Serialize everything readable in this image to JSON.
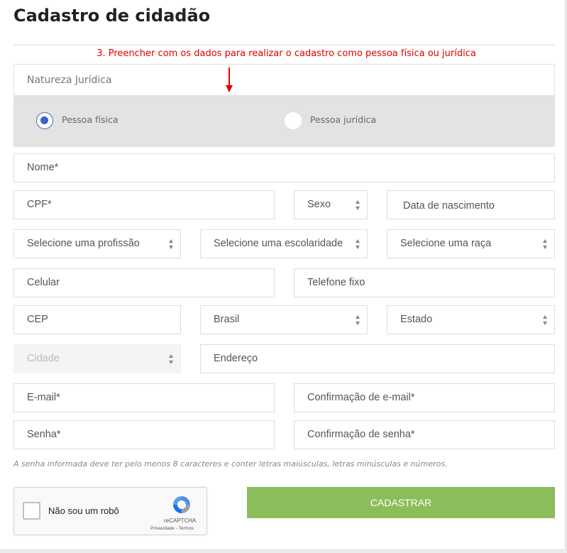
{
  "page": {
    "title": "Cadastro de cidadão"
  },
  "annotation": {
    "text": "3. Preencher com os dados para realizar o cadastro como pessoa física ou jurídica",
    "color": "#e00000"
  },
  "natureza": {
    "label": "Natureza Jurídica",
    "options": [
      {
        "label": "Pessoa física",
        "checked": true
      },
      {
        "label": "Pessoa jurídica",
        "checked": false
      }
    ]
  },
  "fields": {
    "nome": "Nome*",
    "cpf": "CPF*",
    "sexo": "Sexo",
    "data_nascimento": "Data de nascimento",
    "profissao": "Selecione uma profissão",
    "escolaridade": "Selecione uma escolaridade",
    "raca": "Selecione uma raça",
    "celular": "Celular",
    "telefone": "Telefone fixo",
    "cep": "CEP",
    "pais": "Brasil",
    "estado": "Estado",
    "cidade": "Cidade",
    "endereco": "Endereço",
    "email": "E-mail*",
    "email_confirm": "Confirmação de e-mail*",
    "senha": "Senha*",
    "senha_confirm": "Confirmação de senha*"
  },
  "password_hint": "A senha informada deve ter pelo menos 8 caracteres e conter letras maiúsculas, letras minúsculas e números.",
  "captcha": {
    "label": "Não sou um robô",
    "brand": "reCAPTCHA",
    "links": "Privacidade - Termos"
  },
  "submit": {
    "label": "CADASTRAR",
    "color": "#8bbe5b"
  }
}
